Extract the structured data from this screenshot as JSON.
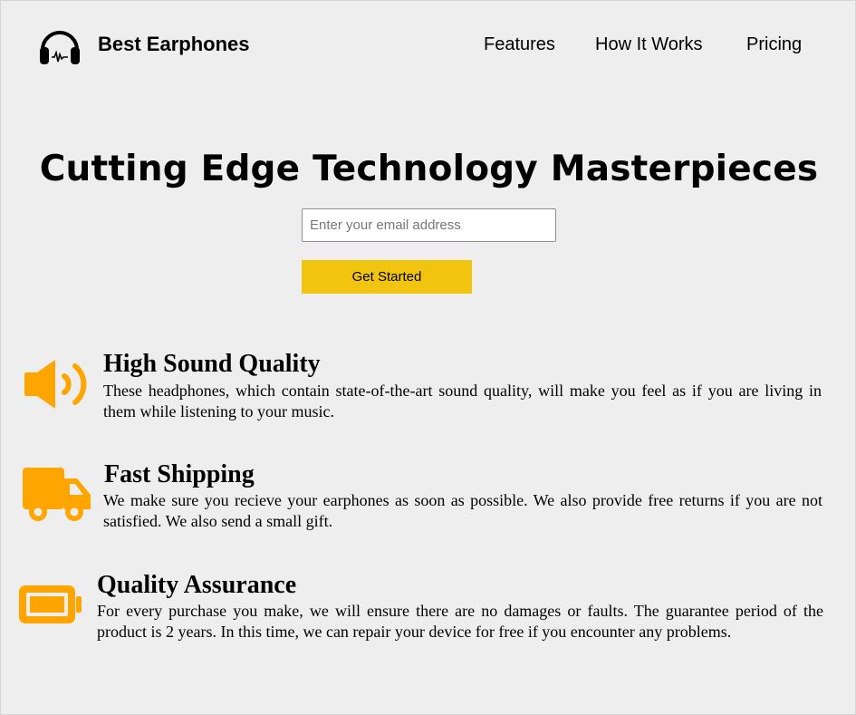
{
  "header": {
    "logo_icon": "headphones-icon",
    "brand": "Best Earphones",
    "nav": [
      {
        "label": "Features"
      },
      {
        "label": "How It Works"
      },
      {
        "label": "Pricing"
      }
    ]
  },
  "hero": {
    "title": "Cutting Edge Technology Masterpieces",
    "email_placeholder": "Enter your email address",
    "email_value": "",
    "cta_label": "Get Started"
  },
  "features": [
    {
      "icon": "volume-up-icon",
      "title": "High Sound Quality",
      "text": "These headphones, which contain state-of-the-art sound quality, will make you feel as if you are living in them while listening to your music."
    },
    {
      "icon": "truck-icon",
      "title": "Fast Shipping",
      "text": "We make sure you recieve your earphones as soon as possible. We also provide free returns if you are not satisfied. We also send a small gift."
    },
    {
      "icon": "battery-icon",
      "title": "Quality Assurance",
      "text": "For every purchase you make, we will ensure there are no damages or faults. The guarantee period of the product is 2 years. In this time, we can repair your device for free if you encounter any problems."
    }
  ],
  "colors": {
    "background": "#eeeeee",
    "accent_button": "#f1c40f",
    "icon_orange": "#ffa500"
  }
}
